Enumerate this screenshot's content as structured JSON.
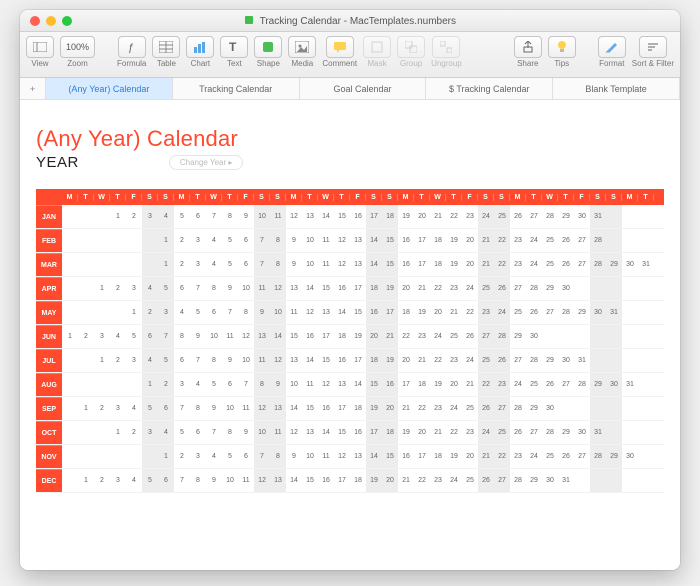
{
  "window": {
    "title": "Tracking Calendar - MacTemplates.numbers"
  },
  "toolbar": {
    "view": "View",
    "zoom": "Zoom",
    "zoom_value": "100%",
    "formula": "Formula",
    "table": "Table",
    "chart": "Chart",
    "text": "Text",
    "shape": "Shape",
    "media": "Media",
    "comment": "Comment",
    "mask": "Mask",
    "group": "Group",
    "ungroup": "Ungroup",
    "share": "Share",
    "tips": "Tips",
    "format": "Format",
    "sort": "Sort & Filter"
  },
  "sheets": {
    "add": "+",
    "items": [
      {
        "label": "(Any Year) Calendar",
        "active": true
      },
      {
        "label": "Tracking Calendar",
        "active": false
      },
      {
        "label": "Goal Calendar",
        "active": false
      },
      {
        "label": "$ Tracking Calendar",
        "active": false
      },
      {
        "label": "Blank Template",
        "active": false
      }
    ]
  },
  "page": {
    "title": "(Any Year) Calendar",
    "subtitle": "YEAR",
    "change_btn": "Change Year ▸"
  },
  "calendar": {
    "day_headers": [
      "M",
      "T",
      "W",
      "T",
      "F",
      "S",
      "S",
      "M",
      "T",
      "W",
      "T",
      "F",
      "S",
      "S",
      "M",
      "T",
      "W",
      "T",
      "F",
      "S",
      "S",
      "M",
      "T",
      "W",
      "T",
      "F",
      "S",
      "S",
      "M",
      "T",
      "W",
      "T",
      "F",
      "S",
      "S",
      "M",
      "T"
    ],
    "weekend_cols": [
      5,
      6,
      12,
      13,
      19,
      20,
      26,
      27,
      33,
      34
    ],
    "months": [
      {
        "label": "JAN",
        "start": 3,
        "days": 31
      },
      {
        "label": "FEB",
        "start": 6,
        "days": 28
      },
      {
        "label": "MAR",
        "start": 6,
        "days": 31
      },
      {
        "label": "APR",
        "start": 2,
        "days": 30
      },
      {
        "label": "MAY",
        "start": 4,
        "days": 31
      },
      {
        "label": "JUN",
        "start": 0,
        "days": 30
      },
      {
        "label": "JUL",
        "start": 2,
        "days": 31
      },
      {
        "label": "AUG",
        "start": 5,
        "days": 31
      },
      {
        "label": "SEP",
        "start": 1,
        "days": 30
      },
      {
        "label": "OCT",
        "start": 3,
        "days": 31
      },
      {
        "label": "NOV",
        "start": 6,
        "days": 30
      },
      {
        "label": "DEC",
        "start": 1,
        "days": 31
      }
    ]
  }
}
